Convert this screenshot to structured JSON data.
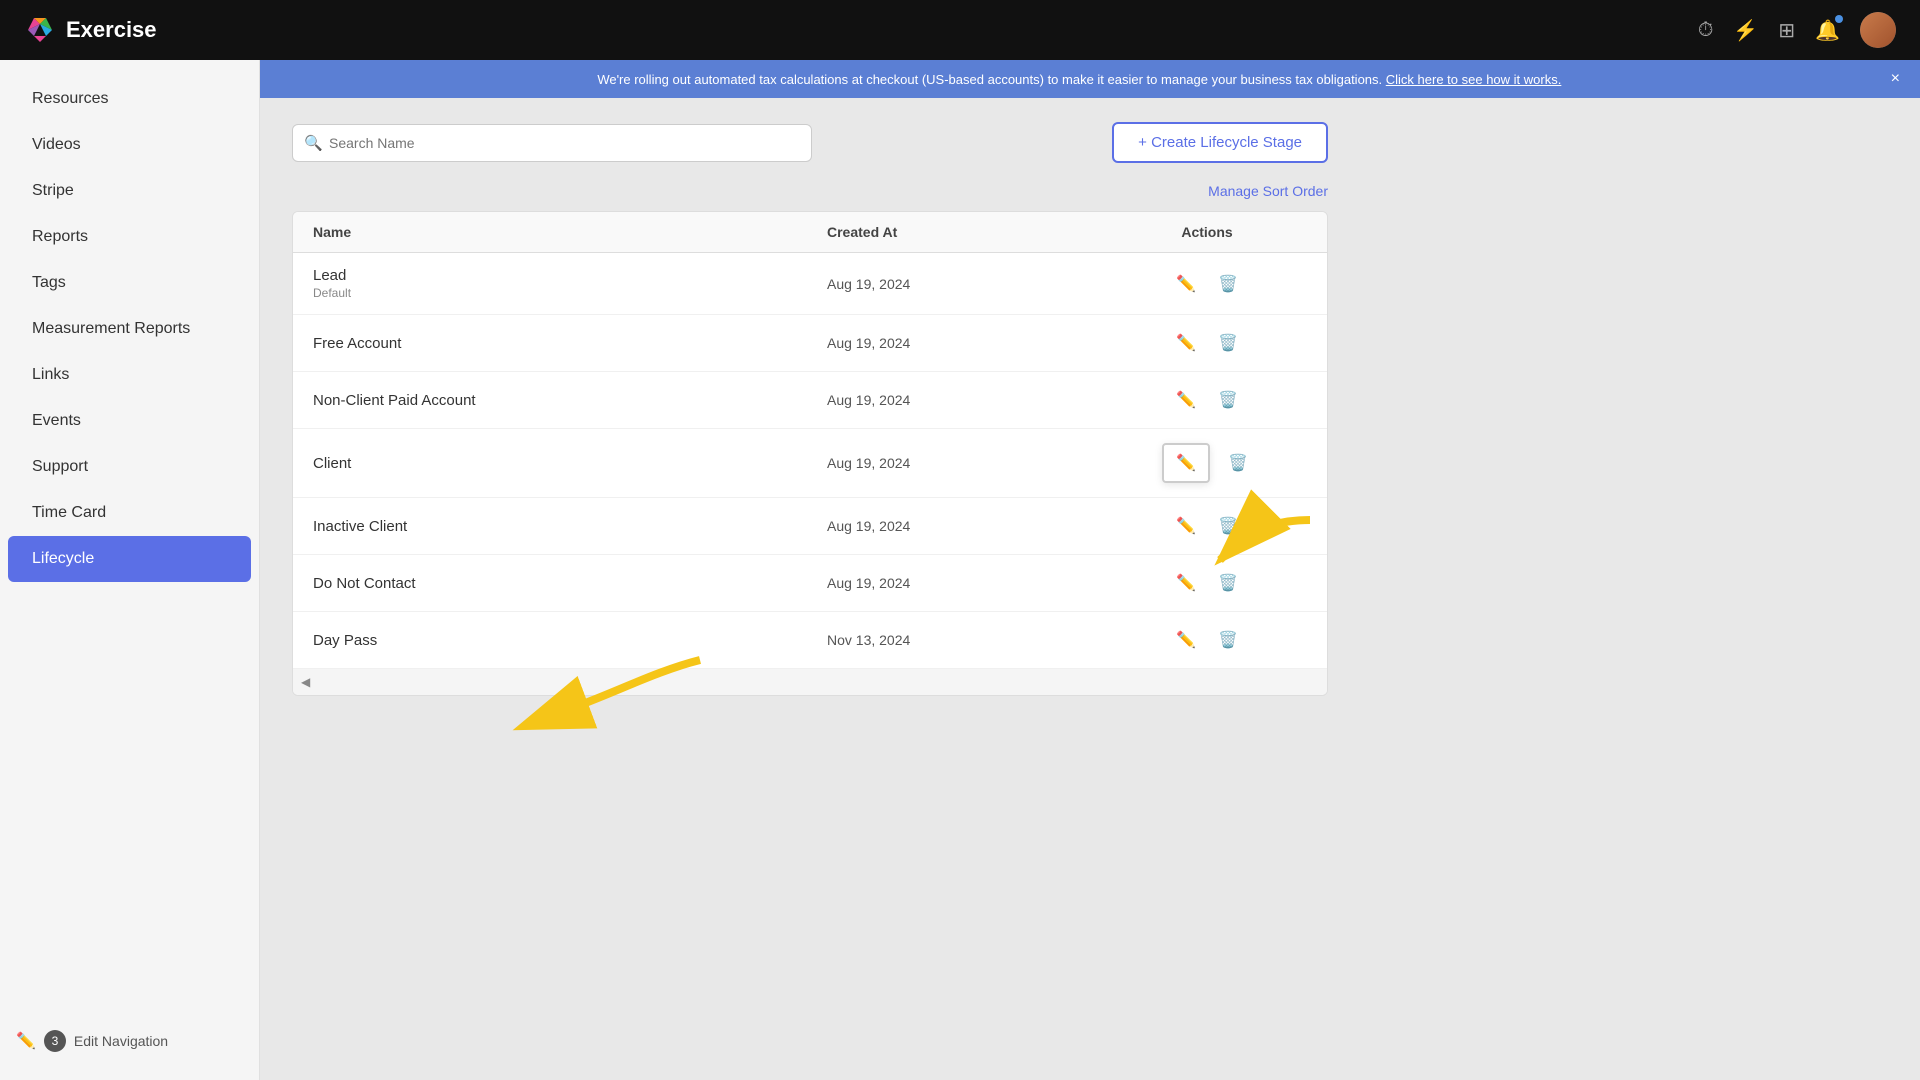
{
  "app": {
    "logo_text": "Exercise",
    "logo_color": "#e84393"
  },
  "topbar": {
    "icons": [
      "history-icon",
      "lightning-icon",
      "grid-icon",
      "notification-icon"
    ],
    "notification_dot": true
  },
  "announcement": {
    "text": "We're rolling out automated tax calculations at checkout (US-based accounts) to make it easier to manage your business tax obligations.",
    "link_text": "Click here to see how it works.",
    "close_label": "×"
  },
  "sidebar": {
    "items": [
      {
        "label": "Resources",
        "active": false
      },
      {
        "label": "Videos",
        "active": false
      },
      {
        "label": "Stripe",
        "active": false
      },
      {
        "label": "Reports",
        "active": false
      },
      {
        "label": "Tags",
        "active": false
      },
      {
        "label": "Measurement Reports",
        "active": false
      },
      {
        "label": "Links",
        "active": false
      },
      {
        "label": "Events",
        "active": false
      },
      {
        "label": "Support",
        "active": false
      },
      {
        "label": "Time Card",
        "active": false
      },
      {
        "label": "Lifecycle",
        "active": true
      }
    ],
    "bottom": {
      "badge": "3",
      "edit_nav_label": "Edit Navigation"
    }
  },
  "toolbar": {
    "search_placeholder": "Search Name",
    "create_button_label": "+ Create Lifecycle Stage"
  },
  "sort_order": {
    "label": "Manage Sort Order"
  },
  "table": {
    "columns": [
      {
        "label": "Name"
      },
      {
        "label": "Created At"
      },
      {
        "label": "Actions"
      }
    ],
    "rows": [
      {
        "name": "Lead",
        "default": "Default",
        "created_at": "Aug 19, 2024"
      },
      {
        "name": "Free Account",
        "default": "",
        "created_at": "Aug 19, 2024"
      },
      {
        "name": "Non-Client Paid Account",
        "default": "",
        "created_at": "Aug 19, 2024"
      },
      {
        "name": "Client",
        "default": "",
        "created_at": "Aug 19, 2024"
      },
      {
        "name": "Inactive Client",
        "default": "",
        "created_at": "Aug 19, 2024"
      },
      {
        "name": "Do Not Contact",
        "default": "",
        "created_at": "Aug 19, 2024"
      },
      {
        "name": "Day Pass",
        "default": "",
        "created_at": "Nov 13, 2024"
      }
    ]
  }
}
